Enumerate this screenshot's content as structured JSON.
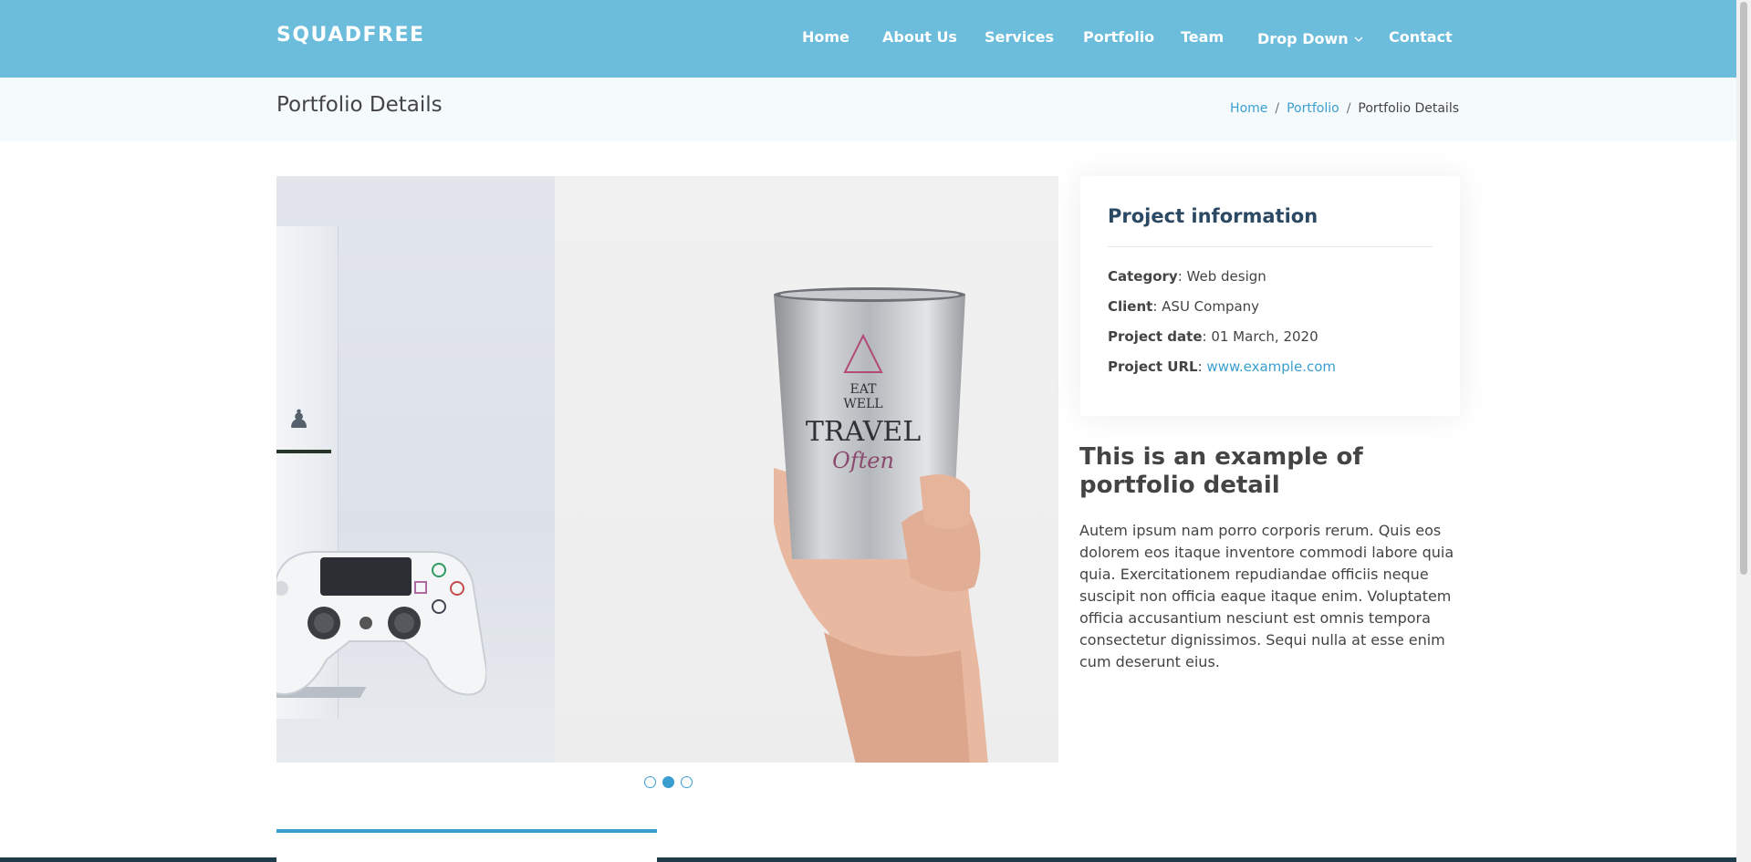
{
  "header": {
    "logo": "SQUADFREE",
    "nav": [
      {
        "label": "Home"
      },
      {
        "label": "About Us"
      },
      {
        "label": "Services"
      },
      {
        "label": "Portfolio"
      },
      {
        "label": "Team"
      },
      {
        "label": "Drop Down",
        "has_dropdown": true,
        "icon": "chevron-down-icon"
      },
      {
        "label": "Contact"
      }
    ]
  },
  "breadcrumbs": {
    "title": "Portfolio Details",
    "items": [
      "Home",
      "Portfolio",
      "Portfolio Details"
    ],
    "separator": "/"
  },
  "slider": {
    "dot_count": 3,
    "active_index": 1,
    "cup_print_text": [
      "EAT",
      "WELL",
      "TRAVEL",
      "Often"
    ]
  },
  "project_info": {
    "title": "Project information",
    "fields": [
      {
        "label": "Category",
        "value": "Web design"
      },
      {
        "label": "Client",
        "value": "ASU Company"
      },
      {
        "label": "Project date",
        "value": "01 March, 2020"
      },
      {
        "label": "Project URL",
        "value": "www.example.com",
        "is_link": true
      }
    ]
  },
  "description": {
    "title": "This is an example of portfolio detail",
    "text": "Autem ipsum nam porro corporis rerum. Quis eos dolorem eos itaque inventore commodi labore quia quia. Exercitationem repudiandae officiis neque suscipit non officia eaque itaque enim. Voluptatem officia accusantium nesciunt est omnis tempora consectetur dignissimos. Sequi nulla at esse enim cum deserunt eius."
  },
  "colors": {
    "header_bg": "#6cbcdc",
    "accent": "#3a9fd0",
    "breadcrumb_bg": "#f5fafd",
    "footer_bg": "#203b4a"
  }
}
